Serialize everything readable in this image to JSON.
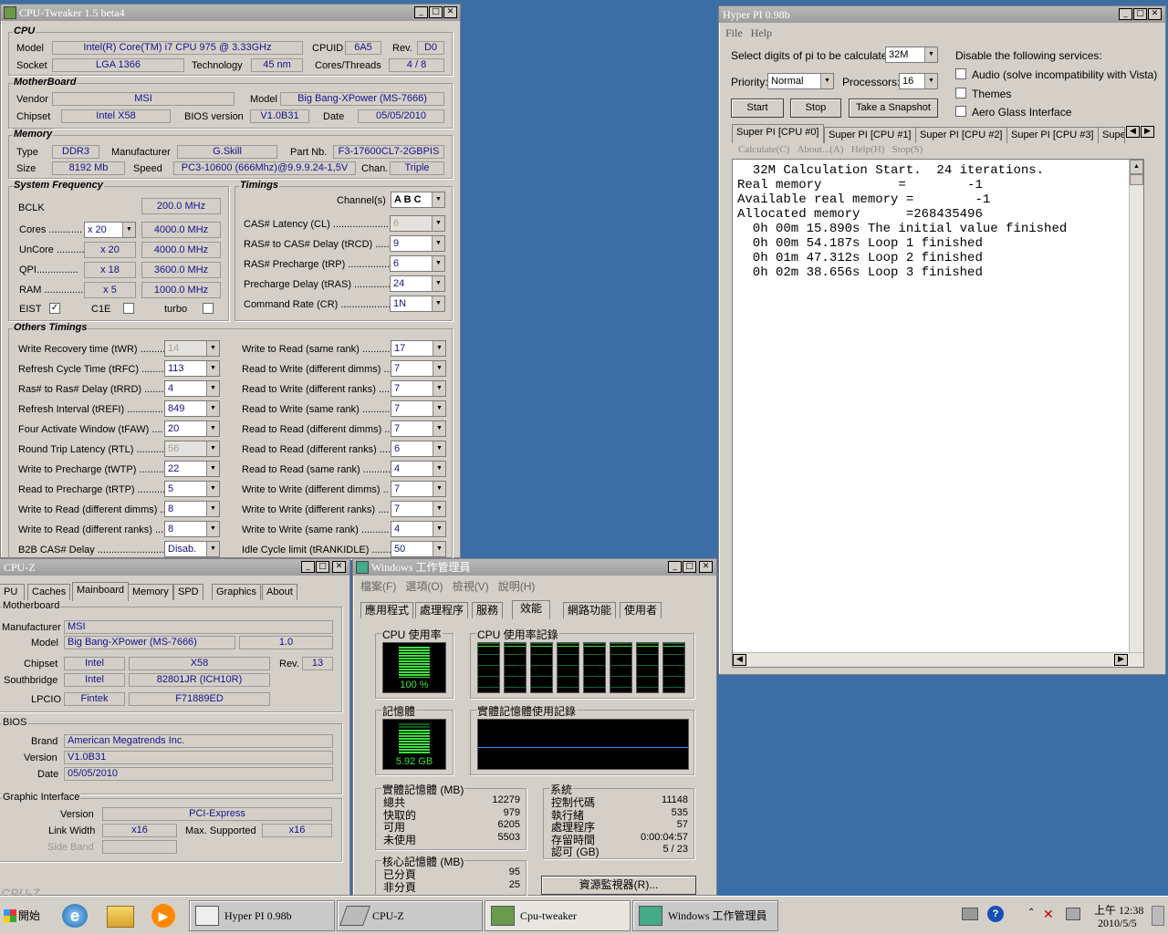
{
  "cputweaker": {
    "title": "CPU-Tweaker 1.5 beta4",
    "cpu": {
      "header": "CPU",
      "model_label": "Model",
      "model": "Intel(R) Core(TM) i7 CPU       975  @ 3.33GHz",
      "cpuid_label": "CPUID",
      "cpuid": "6A5",
      "rev_label": "Rev.",
      "rev": "D0",
      "socket_label": "Socket",
      "socket": "LGA 1366",
      "tech_label": "Technology",
      "tech": "45 nm",
      "ct_label": "Cores/Threads",
      "ct": "4 / 8"
    },
    "mb": {
      "header": "MotherBoard",
      "vendor_label": "Vendor",
      "vendor": "MSI",
      "model_label": "Model",
      "model": "Big Bang-XPower (MS-7666)",
      "chipset_label": "Chipset",
      "chipset": "Intel X58",
      "bios_label": "BIOS version",
      "bios": "V1.0B31",
      "date_label": "Date",
      "date": "05/05/2010"
    },
    "mem": {
      "header": "Memory",
      "type_label": "Type",
      "type": "DDR3",
      "manu_label": "Manufacturer",
      "manu": "G.Skill",
      "part_label": "Part Nb.",
      "part": "F3-17600CL7-2GBPIS",
      "size_label": "Size",
      "size": "8192 Mb",
      "speed_label": "Speed",
      "speed": "PC3-10600 (666Mhz)@9.9.9.24-1,5V",
      "chan_label": "Chan.",
      "chan": "Triple"
    },
    "sysfreq": {
      "header": "System Frequency",
      "bclk_label": "BCLK",
      "bclk": "200.0 MHz",
      "rows": [
        {
          "label": "Cores ............",
          "mult": "x 20",
          "freq": "4000.0 MHz"
        },
        {
          "label": "UnCore ..........",
          "mult": "x 20",
          "freq": "4000.0 MHz"
        },
        {
          "label": "QPI...............",
          "mult": "x 18",
          "freq": "3600.0 MHz"
        },
        {
          "label": "RAM ...............",
          "mult": "x 5",
          "freq": "1000.0 MHz"
        }
      ],
      "eist": "EIST",
      "c1e": "C1E",
      "turbo": "turbo",
      "check": "✓"
    },
    "timings": {
      "header": "Timings",
      "channels_label": "Channel(s)",
      "channels": "A B C",
      "rows": [
        {
          "label": "CAS# Latency (CL) ......................",
          "value": "6"
        },
        {
          "label": "RAS# to CAS# Delay (tRCD) ......",
          "value": "9"
        },
        {
          "label": "RAS# Precharge (tRP) ...............",
          "value": "6"
        },
        {
          "label": "Precharge Delay (tRAS) ..............",
          "value": "24"
        },
        {
          "label": "Command Rate (CR) ...................",
          "value": "1N"
        }
      ]
    },
    "others": {
      "header": "Others Timings",
      "left": [
        {
          "label": "Write Recovery time (tWR) .........",
          "value": "14"
        },
        {
          "label": "Refresh Cycle Time (tRFC) .........",
          "value": "113"
        },
        {
          "label": "Ras# to Ras# Delay (tRRD) .........",
          "value": "4"
        },
        {
          "label": "Refresh Interval (tREFI) .............",
          "value": "849"
        },
        {
          "label": "Four Activate Window (tFAW) ....",
          "value": "20"
        },
        {
          "label": "Round Trip Latency (RTL) ..........",
          "value": "56"
        },
        {
          "label": "Write to Precharge (tWTP) ..........",
          "value": "22"
        },
        {
          "label": "Read to Precharge (tRTP) ...........",
          "value": "5"
        },
        {
          "label": "Write to Read (different dimms) ..",
          "value": "8"
        },
        {
          "label": "Write to Read (different ranks) ...",
          "value": "8"
        },
        {
          "label": "B2B CAS# Delay ...........................",
          "value": "Disab."
        }
      ],
      "right": [
        {
          "label": "Write to Read (same rank) ...........",
          "value": "17"
        },
        {
          "label": "Read to Write (different dimms) ...",
          "value": "7"
        },
        {
          "label": "Read to Write (different ranks) ....",
          "value": "7"
        },
        {
          "label": "Read to Write (same rank) ...........",
          "value": "7"
        },
        {
          "label": "Read to Read (different dimms) ....",
          "value": "7"
        },
        {
          "label": "Read to Read (different ranks) .....",
          "value": "6"
        },
        {
          "label": "Read to Read (same rank) .............",
          "value": "4"
        },
        {
          "label": "Write to Write (different dimms) ..",
          "value": "7"
        },
        {
          "label": "Write to Write (different ranks) ....",
          "value": "7"
        },
        {
          "label": "Write to Write (same rank) ..........",
          "value": "4"
        },
        {
          "label": "Idle Cycle limit (tRANKIDLE) ........",
          "value": "50"
        }
      ]
    }
  },
  "hyperpi": {
    "title": "Hyper PI 0.98b",
    "menu": [
      "File",
      "Help"
    ],
    "digits_label": "Select digits of pi to be calculated:",
    "digits": "32M",
    "priority_label": "Priority:",
    "priority": "Normal",
    "proc_label": "Processors:",
    "proc": "16",
    "start": "Start",
    "stop": "Stop",
    "snapshot": "Take a Snapshot",
    "services_label": "Disable the following services:",
    "services": [
      "Audio (solve incompatibility with Vista)",
      "Themes",
      "Aero Glass Interface"
    ],
    "tabs": [
      "Super PI [CPU #0]",
      "Super PI [CPU #1]",
      "Super PI [CPU #2]",
      "Super PI [CPU #3]",
      "Supe"
    ],
    "submenu": [
      "Calculate(C)",
      "About...(A)",
      "Help(H)",
      "Stop(S)"
    ],
    "output": "  32M Calculation Start.  24 iterations.\nReal memory          =        -1\nAvailable real memory =        -1\nAllocated memory      =268435496\n  0h 00m 15.890s The initial value finished\n  0h 00m 54.187s Loop 1 finished\n  0h 01m 47.312s Loop 2 finished\n  0h 02m 38.656s Loop 3 finished"
  },
  "cpuz": {
    "title": "CPU-Z",
    "tabs": [
      "PU",
      "Caches",
      "Mainboard",
      "Memory",
      "SPD",
      "Graphics",
      "About"
    ],
    "mb_header": "Motherboard",
    "manu_label": "Manufacturer",
    "manu": "MSI",
    "model_label": "Model",
    "model": "Big Bang-XPower (MS-7666)",
    "model_rev": "1.0",
    "chipset_label": "Chipset",
    "chipset_v": "Intel",
    "chipset_n": "X58",
    "rev_label": "Rev.",
    "rev": "13",
    "sb_label": "Southbridge",
    "sb_v": "Intel",
    "sb_n": "82801JR (ICH10R)",
    "lpcio_label": "LPCIO",
    "lpcio_v": "Fintek",
    "lpcio_n": "F71889ED",
    "bios_header": "BIOS",
    "brand_label": "Brand",
    "brand": "American Megatrends Inc.",
    "ver_label": "Version",
    "ver": "V1.0B31",
    "date_label": "Date",
    "date": "05/05/2010",
    "gi_header": "Graphic Interface",
    "gver_label": "Version",
    "gver": "PCI-Express",
    "lw_label": "Link Width",
    "lw": "x16",
    "ms_label": "Max. Supported",
    "ms": "x16",
    "sb2_label": "Side Band",
    "bottom": "CPU-Z"
  },
  "taskmgr": {
    "title": "Windows 工作管理員",
    "menu": [
      "檔案(F)",
      "選項(O)",
      "檢視(V)",
      "說明(H)"
    ],
    "tabs": [
      "應用程式",
      "處理程序",
      "服務",
      "效能",
      "網路功能",
      "使用者"
    ],
    "cpu_usage": "CPU 使用率",
    "cpu_pct": "100 %",
    "cpu_history": "CPU 使用率記錄",
    "mem": "記憶體",
    "mem_val": "5.92 GB",
    "mem_history": "實體記憶體使用記錄",
    "phys_header": "實體記憶體 (MB)",
    "phys": [
      {
        "k": "總共",
        "v": "12279"
      },
      {
        "k": "快取的",
        "v": "979"
      },
      {
        "k": "可用",
        "v": "6205"
      },
      {
        "k": "未使用",
        "v": "5503"
      }
    ],
    "sys_header": "系統",
    "sys": [
      {
        "k": "控制代碼",
        "v": "11148"
      },
      {
        "k": "執行緒",
        "v": "535"
      },
      {
        "k": "處理程序",
        "v": "57"
      },
      {
        "k": "存留時間",
        "v": "0:00:04:57"
      },
      {
        "k": "認可 (GB)",
        "v": "5 / 23"
      }
    ],
    "kern_header": "核心記憶體 (MB)",
    "kern": [
      {
        "k": "已分頁",
        "v": "95"
      },
      {
        "k": "非分頁",
        "v": "25"
      }
    ],
    "resmon": "資源監視器(R)...",
    "cpu_level": 1.0
  },
  "taskbar": {
    "start": "開始",
    "items": [
      "Hyper PI 0.98b",
      "CPU-Z",
      "Cpu-tweaker",
      "Windows 工作管理員"
    ],
    "time": "上午 12:38",
    "date": "2010/5/5"
  }
}
